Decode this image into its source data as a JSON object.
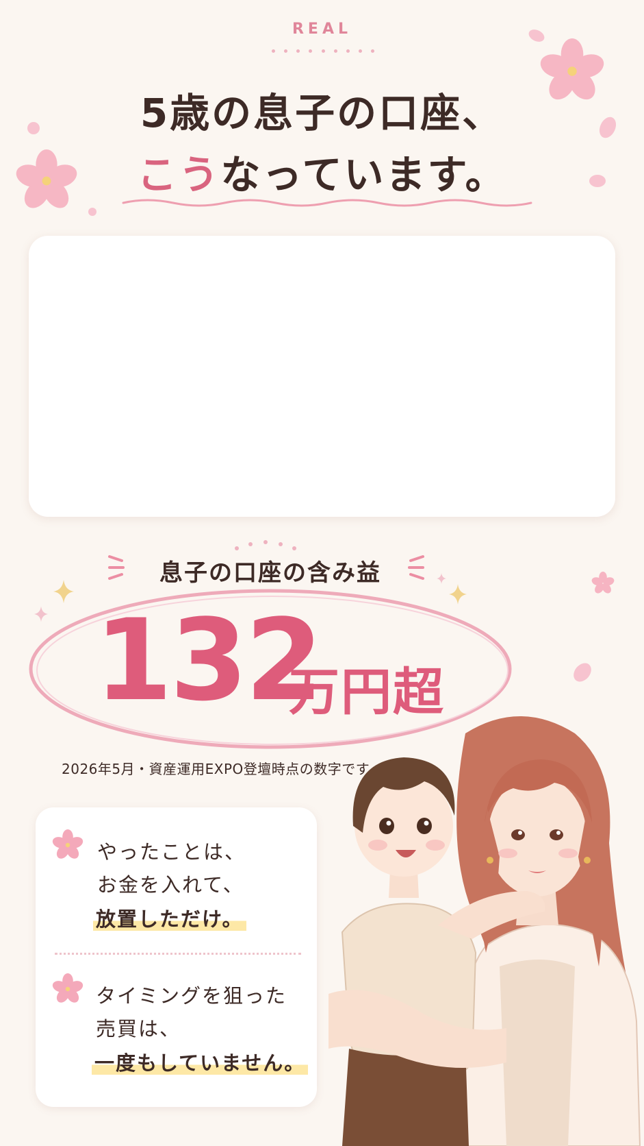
{
  "header": {
    "eyebrow": "REAL",
    "title_line1": "5歳の息子の口座、",
    "title_line2_accent": "こう",
    "title_line2_rest": "なっています。"
  },
  "gains": {
    "label": "息子の口座の含み益",
    "amount": "132",
    "unit": "万円超",
    "note": "2026年5月・資産運用EXPO登壇時点の数字です"
  },
  "card": {
    "item1": {
      "line1": "やったことは、",
      "line2": "お金を入れて、",
      "highlight": "放置しただけ。"
    },
    "item2": {
      "line1": "タイミングを狙った",
      "line2": "売買は、",
      "highlight": "一度もしていません。"
    }
  },
  "colors": {
    "accent": "#de5c7b",
    "background": "#fbf6f1",
    "highlight": "#fde8a6",
    "blossom": "#f4a9ba"
  },
  "icons": {
    "blossom": "cherry-blossom-icon",
    "sparkle": "sparkle-icon"
  }
}
